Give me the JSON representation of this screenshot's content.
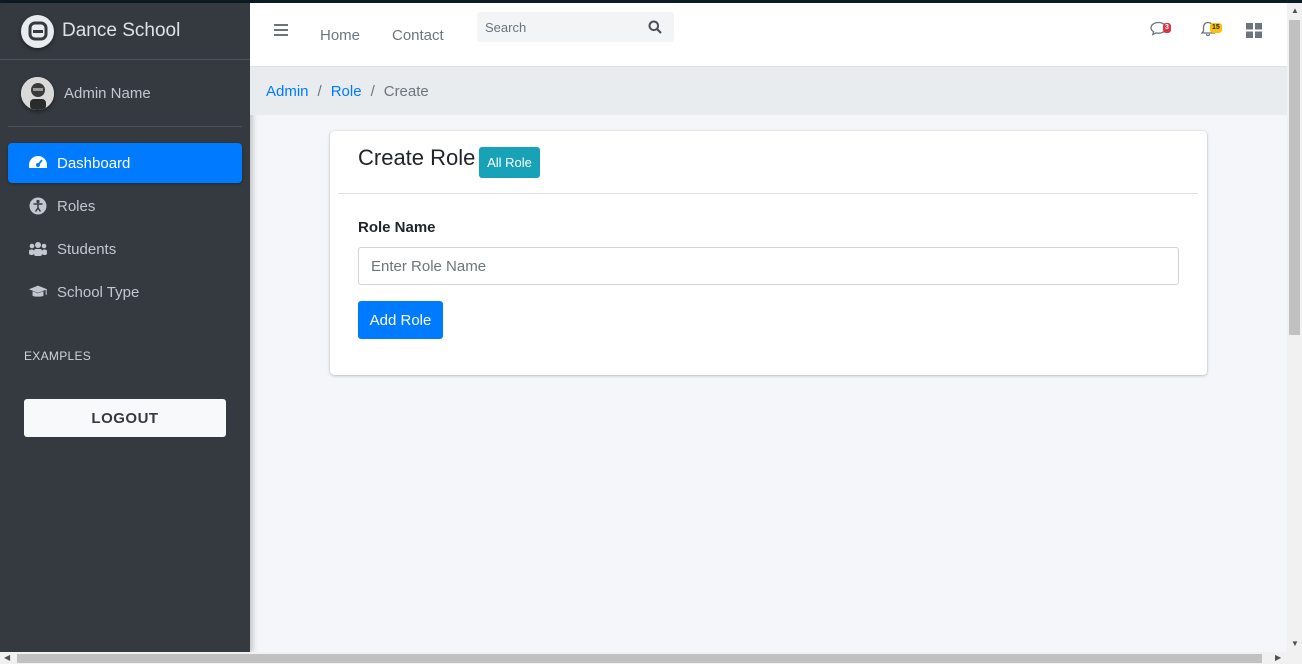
{
  "app": {
    "brand": "Dance School"
  },
  "sidebar": {
    "user_name": "Admin Name",
    "items": [
      {
        "label": "Dashboard",
        "icon": "tachometer-icon",
        "active": true
      },
      {
        "label": "Roles",
        "icon": "accessibility-icon",
        "active": false
      },
      {
        "label": "Students",
        "icon": "users-icon",
        "active": false
      },
      {
        "label": "School Type",
        "icon": "graduation-cap-icon",
        "active": false
      }
    ],
    "section_header": "EXAMPLES",
    "logout_label": "LOGOUT"
  },
  "header": {
    "links": [
      "Home",
      "Contact"
    ],
    "search_placeholder": "Search",
    "messages_count": "3",
    "notifications_count": "15"
  },
  "breadcrumb": {
    "items": [
      "Admin",
      "Role"
    ],
    "current": "Create"
  },
  "card": {
    "title": "Create Role",
    "all_role_label": "All Role",
    "field_label": "Role Name",
    "field_placeholder": "Enter Role Name",
    "submit_label": "Add Role"
  },
  "colors": {
    "primary": "#007bff",
    "info": "#17a2b8",
    "sidebar_bg": "#343a40",
    "danger": "#dc3545",
    "warning": "#ffc107"
  }
}
